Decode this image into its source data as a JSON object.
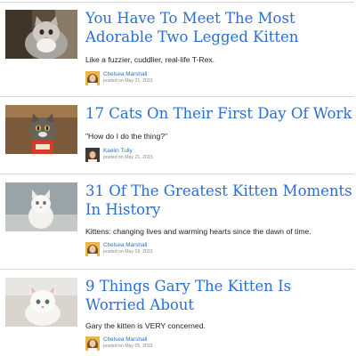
{
  "articles": [
    {
      "title": "You Have To Meet The Most Adorable Two Legged Kitten",
      "description": "Like a fuzzier, cuddlier, real-life T-Rex.",
      "author": "Chelsea Marshall",
      "posted": "posted on May 21, 2015"
    },
    {
      "title": "17 Cats On Their First Day Of Work",
      "description": "\"How do I do the thing?\"",
      "author": "Kaelin Tully",
      "posted": "posted on May 21, 2015"
    },
    {
      "title": "31 Of The Greatest Kitten Moments In History",
      "description": "Kittens: changing lives and warming hearts since the dawn of time.",
      "author": "Chelsea Marshall",
      "posted": "posted on May 19, 2015"
    },
    {
      "title": "9 Things Gary The Kitten Is Worried About",
      "description": "Gary the kitten is VERY concerned.",
      "author": "Chelsea Marshall",
      "posted": "posted on May 05, 2015"
    }
  ],
  "colors": {
    "link": "#2a6fd0",
    "text": "#222222",
    "meta": "#888888",
    "divider": "#d8d8d8"
  }
}
